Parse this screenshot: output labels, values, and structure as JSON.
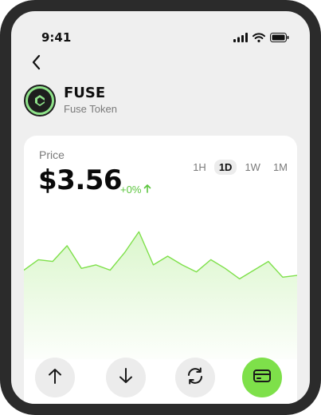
{
  "status_bar": {
    "time": "9:41"
  },
  "token": {
    "symbol": "FUSE",
    "name": "Fuse Token"
  },
  "price": {
    "label": "Price",
    "value": "$3.56",
    "change": "+0%"
  },
  "timeframes": [
    "1H",
    "1D",
    "1W",
    "1M"
  ],
  "selected_timeframe": "1D",
  "colors": {
    "accent": "#7ee04a",
    "chart_line": "#7ee04a",
    "positive": "#5cc53e"
  },
  "actions": [
    {
      "icon": "arrow-up-icon"
    },
    {
      "icon": "arrow-down-icon"
    },
    {
      "icon": "swap-icon"
    },
    {
      "icon": "card-icon"
    }
  ],
  "chart_data": {
    "type": "area",
    "values": [
      3.38,
      3.44,
      3.43,
      3.52,
      3.39,
      3.41,
      3.38,
      3.48,
      3.6,
      3.41,
      3.46,
      3.41,
      3.37,
      3.44,
      3.39,
      3.33,
      3.38,
      3.43,
      3.34,
      3.35
    ]
  }
}
